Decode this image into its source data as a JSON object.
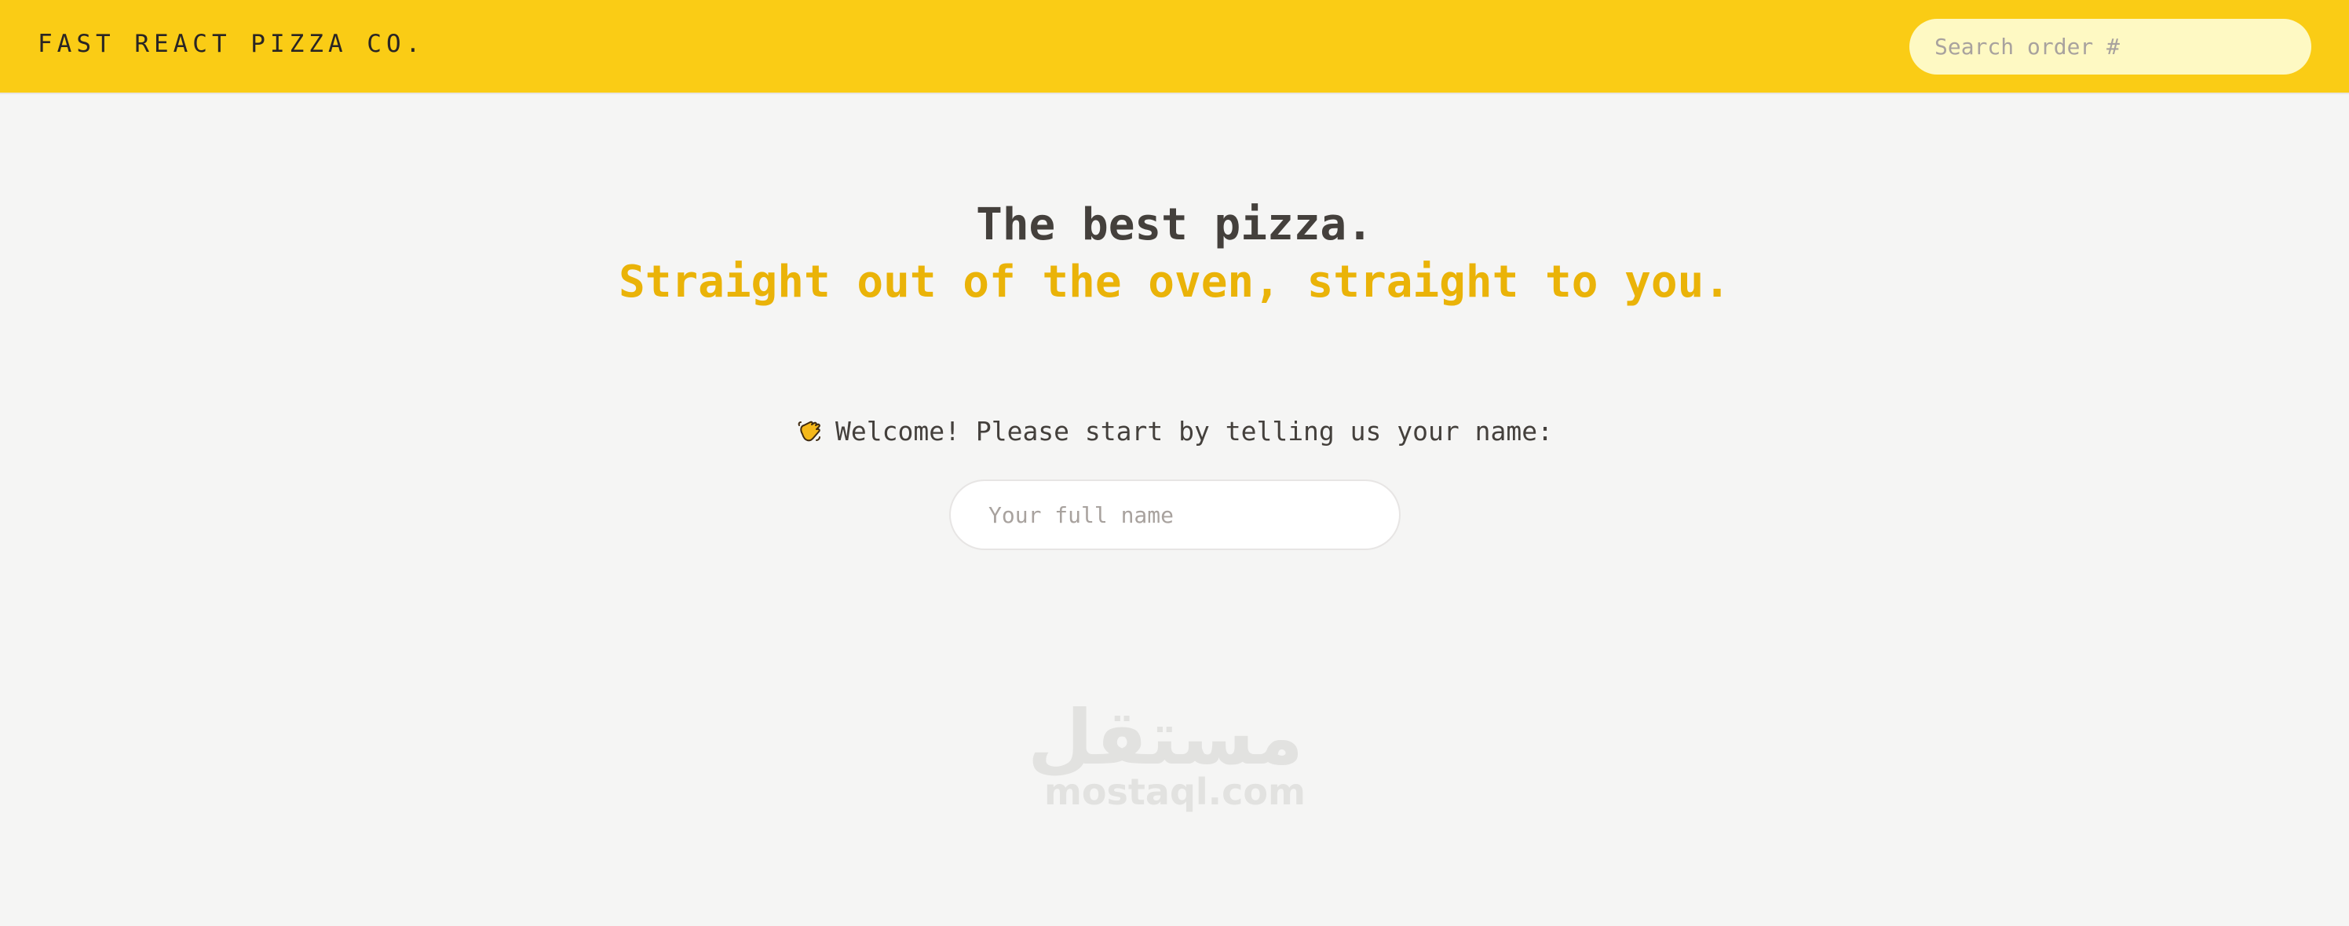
{
  "header": {
    "logo": "FAST REACT PIZZA CO.",
    "search_placeholder": "Search order #"
  },
  "hero": {
    "title": "The best pizza.",
    "subtitle": "Straight out of the oven, straight to you."
  },
  "welcome": {
    "icon": "waving-hand-icon",
    "text": "Welcome! Please start by telling us your name:",
    "name_placeholder": "Your full name"
  },
  "watermark": {
    "arabic": "مستقل",
    "latin": "mostaql.com"
  },
  "colors": {
    "header_bg": "#facc15",
    "page_bg": "#f5f5f4",
    "accent": "#eab308",
    "text": "#44403c"
  }
}
